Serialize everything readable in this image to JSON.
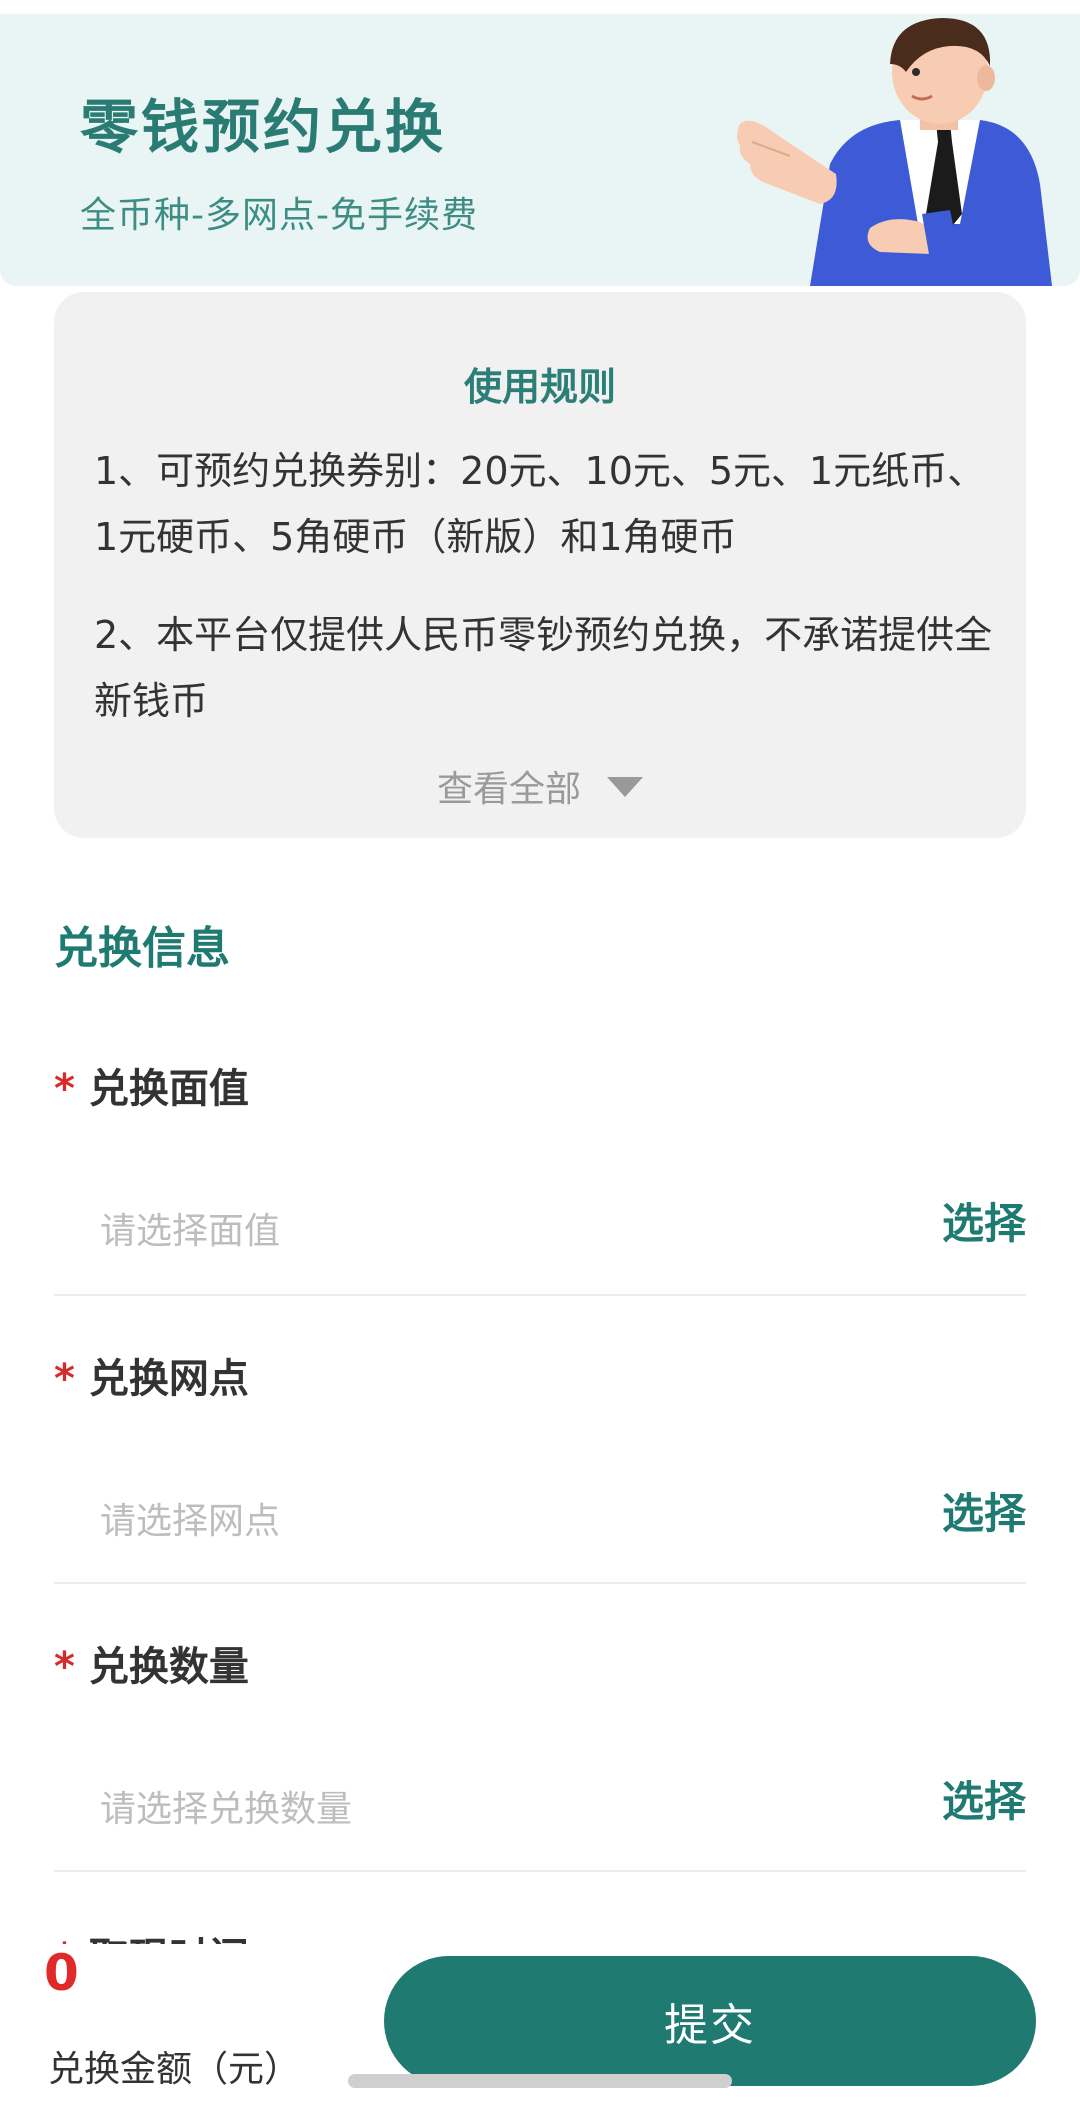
{
  "banner": {
    "title": "零钱预约兑换",
    "subtitle": "全币种-多网点-免手续费"
  },
  "rules": {
    "title": "使用规则",
    "items": [
      "1、可预约兑换券别：20元、10元、5元、1元纸币、1元硬币、5角硬币（新版）和1角硬币",
      "2、本平台仅提供人民币零钞预约兑换，不承诺提供全新钱币"
    ],
    "view_all": "查看全部"
  },
  "form": {
    "section_title": "兑换信息",
    "required_mark": "*",
    "fields": [
      {
        "label": "兑换面值",
        "placeholder": "请选择面值",
        "action": "选择"
      },
      {
        "label": "兑换网点",
        "placeholder": "请选择网点",
        "action": "选择"
      },
      {
        "label": "兑换数量",
        "placeholder": "请选择兑换数量",
        "action": "选择"
      }
    ],
    "partial_field_label": "取现时间"
  },
  "footer": {
    "amount": "0",
    "amount_label": "兑换金额（元）",
    "submit_label": "提交"
  },
  "colors": {
    "accent": "#1f7a72",
    "banner_bg": "#e9f5f4",
    "required": "#d62b2b",
    "amount": "#e02a2a"
  }
}
